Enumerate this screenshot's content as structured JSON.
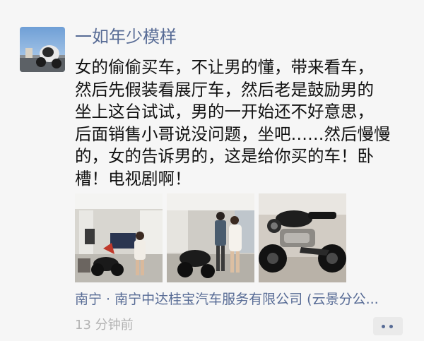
{
  "post": {
    "username": "一如年少模样",
    "content_lines": [
      "女的偷偷买车，不让男的懂，带来看车，",
      "然后先假装看展厅车，然后老是鼓励男的",
      "坐上这台试试，男的一开始还不好意思，",
      "后面销售小哥说没问题，坐吧……然后慢慢",
      "的，女的告诉男的，这是给你买的车！卧",
      "槽！电视剧啊！"
    ],
    "location": "南宁 · 南宁中达桂宝汽车服务有限公司 (云景分公...",
    "time": "13 分钟前",
    "photos": [
      {
        "icon": "showroom-photo"
      },
      {
        "icon": "couple-motorcycle-photo"
      },
      {
        "icon": "motorcycle-closeup-photo"
      }
    ]
  },
  "colors": {
    "username": "#576b95",
    "text": "#111111",
    "time": "#b2b2b2",
    "background": "#f6f6f6"
  }
}
